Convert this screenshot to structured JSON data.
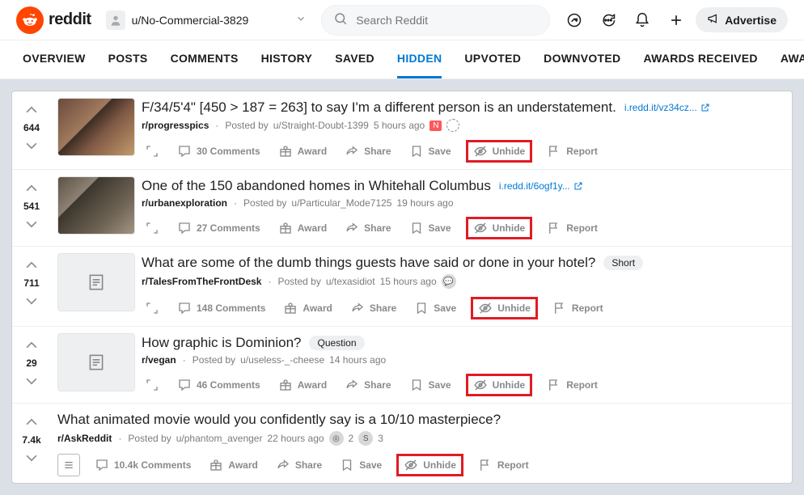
{
  "brand": "reddit",
  "user_chip": "u/No-Commercial-3829",
  "search": {
    "placeholder": "Search Reddit"
  },
  "topbar": {
    "advertise": "Advertise"
  },
  "tabs": [
    "OVERVIEW",
    "POSTS",
    "COMMENTS",
    "HISTORY",
    "SAVED",
    "HIDDEN",
    "UPVOTED",
    "DOWNVOTED",
    "AWARDS RECEIVED",
    "AWARDS GIVEN"
  ],
  "active_tab": 5,
  "action_labels": {
    "award": "Award",
    "share": "Share",
    "save": "Save",
    "unhide": "Unhide",
    "report": "Report"
  },
  "posts": [
    {
      "score": "644",
      "title": "F/34/5'4\" [450 > 187 = 263] to say I'm a different person is an understatement.",
      "link": "i.redd.it/vz34cz...",
      "subreddit": "r/progresspics",
      "author": "u/Straight-Doubt-1399",
      "age": "5 hours ago",
      "nsfw": true,
      "thumb": "photo1",
      "comments": "30 Comments",
      "meta_award_icon": true
    },
    {
      "score": "541",
      "title": "One of the 150 abandoned homes in Whitehall Columbus",
      "link": "i.redd.it/6ogf1y...",
      "subreddit": "r/urbanexploration",
      "author": "u/Particular_Mode7125",
      "age": "19 hours ago",
      "thumb": "photo2",
      "comments": "27 Comments"
    },
    {
      "score": "711",
      "title": "What are some of the dumb things guests have said or done in your hotel?",
      "flair": "Short",
      "subreddit": "r/TalesFromTheFrontDesk",
      "author": "u/texasidiot",
      "age": "15 hours ago",
      "thumb": "text",
      "comments": "148 Comments",
      "meta_trailing_icon": "chat"
    },
    {
      "score": "29",
      "title": "How graphic is Dominion?",
      "flair": "Question",
      "subreddit": "r/vegan",
      "author": "u/useless-_-cheese",
      "age": "14 hours ago",
      "thumb": "text",
      "comments": "46 Comments"
    },
    {
      "score": "7.4k",
      "title": "What animated movie would you confidently say is a 10/10 masterpiece?",
      "subreddit": "r/AskReddit",
      "author": "u/phantom_avenger",
      "age": "22 hours ago",
      "thumb": "none",
      "comments": "10.4k Comments",
      "awards": [
        {
          "icon": "silver",
          "count": "2"
        },
        {
          "icon": "s",
          "count": "3"
        }
      ],
      "list_layout_btn": true
    }
  ]
}
